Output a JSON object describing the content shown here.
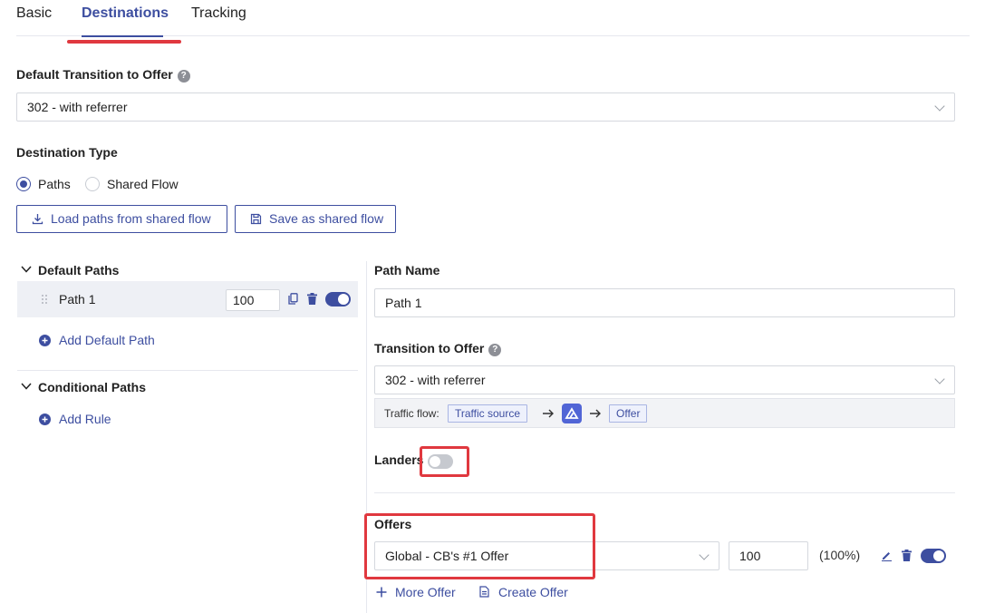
{
  "tabs": [
    {
      "label": "Basic",
      "active": false
    },
    {
      "label": "Destinations",
      "active": true
    },
    {
      "label": "Tracking",
      "active": false
    }
  ],
  "default_transition": {
    "label": "Default Transition to Offer",
    "value": "302 - with referrer"
  },
  "destination_type": {
    "label": "Destination Type",
    "options": [
      "Paths",
      "Shared Flow"
    ],
    "selected": "Paths"
  },
  "buttons": {
    "load_paths": "Load paths from shared flow",
    "save_shared": "Save as shared flow"
  },
  "default_paths": {
    "title": "Default Paths",
    "items": [
      {
        "name": "Path 1",
        "weight": "100",
        "enabled": true
      }
    ],
    "add_label": "Add Default Path"
  },
  "conditional_paths": {
    "title": "Conditional Paths",
    "add_label": "Add Rule"
  },
  "path_editor": {
    "name_label": "Path Name",
    "name_value": "Path 1",
    "transition_label": "Transition to Offer",
    "transition_value": "302 - with referrer",
    "traffic_flow_label": "Traffic flow:",
    "traffic_source_chip": "Traffic source",
    "offer_chip": "Offer",
    "landers_label": "Landers",
    "landers_enabled": false,
    "offers_label": "Offers",
    "offers": [
      {
        "name": "Global - CB's #1 Offer",
        "weight": "100",
        "share": "(100%)",
        "enabled": true
      }
    ],
    "more_offer_label": "More Offer",
    "create_offer_label": "Create Offer"
  },
  "colors": {
    "accent": "#3d4ea0",
    "highlight": "#e0383f"
  }
}
